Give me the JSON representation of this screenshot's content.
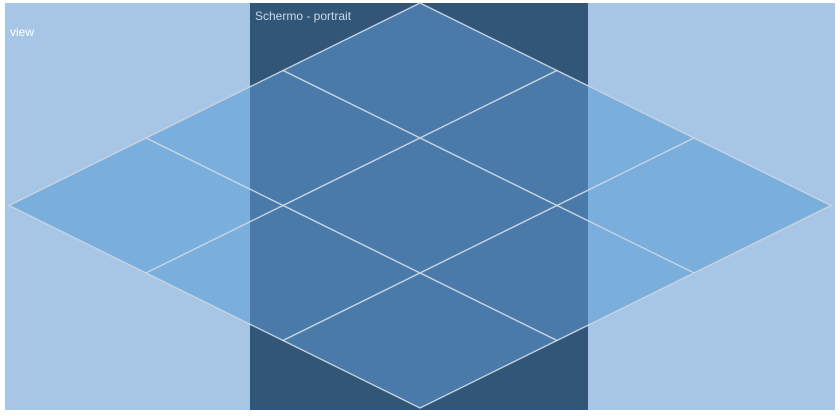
{
  "labels": {
    "view": "view",
    "screen": "Schermo - portrait"
  },
  "colors": {
    "view_background": "#a7c6e6",
    "screen_background": "#325677",
    "tile_outside": "#7aaedd",
    "tile_inside": "#4a7aaa",
    "tile_stroke": "#c8d4e0",
    "view_label": "#ffffff",
    "screen_label": "#c9d9ea"
  },
  "tiles": [
    {
      "id": "top"
    },
    {
      "id": "upper-left"
    },
    {
      "id": "upper-right"
    },
    {
      "id": "far-left"
    },
    {
      "id": "center"
    },
    {
      "id": "far-right"
    },
    {
      "id": "lower-left"
    },
    {
      "id": "lower-right"
    },
    {
      "id": "bottom"
    }
  ]
}
